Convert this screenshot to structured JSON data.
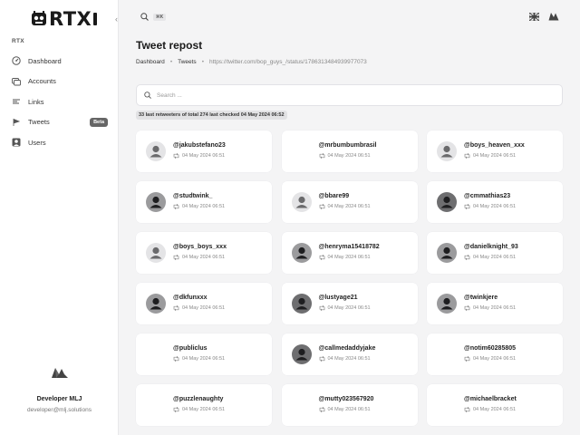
{
  "sidebar": {
    "logo_text": "RTX",
    "collapse_icon": "‹",
    "section_label": "RTX",
    "items": [
      {
        "label": "Dashboard",
        "icon": "gauge-icon"
      },
      {
        "label": "Accounts",
        "icon": "accounts-icon"
      },
      {
        "label": "Links",
        "icon": "links-icon"
      },
      {
        "label": "Tweets",
        "icon": "tweets-icon",
        "badge": "Beta"
      },
      {
        "label": "Users",
        "icon": "users-icon"
      }
    ],
    "profile": {
      "name": "Developer MLJ",
      "email": "developer@mlj.solutions"
    }
  },
  "topbar": {
    "shortcut": "⌘K"
  },
  "page": {
    "title": "Tweet repost",
    "breadcrumb": {
      "home": "Dashboard",
      "section": "Tweets",
      "current": "https://twitter.com/bop_guys_/status/1786313484939977073"
    }
  },
  "search": {
    "placeholder": "Search ..."
  },
  "status": "33 last retweeters of total 274 last checked 04 May 2024 06:52",
  "cards": [
    {
      "username": "@jakubstefano23",
      "date": "04 May 2024 06:51",
      "avatar": "light"
    },
    {
      "username": "@mrbumbumbrasil",
      "date": "04 May 2024 06:51",
      "avatar": "none"
    },
    {
      "username": "@boys_heaven_xxx",
      "date": "04 May 2024 06:51",
      "avatar": "light"
    },
    {
      "username": "@studtwink_",
      "date": "04 May 2024 06:51",
      "avatar": "mid"
    },
    {
      "username": "@bbare99",
      "date": "04 May 2024 06:51",
      "avatar": "light"
    },
    {
      "username": "@cmmathias23",
      "date": "04 May 2024 06:51",
      "avatar": "dark"
    },
    {
      "username": "@boys_boys_xxx",
      "date": "04 May 2024 06:51",
      "avatar": "light"
    },
    {
      "username": "@henryma15418782",
      "date": "04 May 2024 06:51",
      "avatar": "mid"
    },
    {
      "username": "@danielknight_93",
      "date": "04 May 2024 06:51",
      "avatar": "mid"
    },
    {
      "username": "@dkfunxxx",
      "date": "04 May 2024 06:51",
      "avatar": "mid"
    },
    {
      "username": "@lustyage21",
      "date": "04 May 2024 06:51",
      "avatar": "dark"
    },
    {
      "username": "@twinkjere",
      "date": "04 May 2024 06:51",
      "avatar": "mid"
    },
    {
      "username": "@publiclus",
      "date": "04 May 2024 06:51",
      "avatar": "none"
    },
    {
      "username": "@callmedaddyjake",
      "date": "04 May 2024 06:51",
      "avatar": "dark"
    },
    {
      "username": "@notim60285805",
      "date": "04 May 2024 06:51",
      "avatar": "none"
    },
    {
      "username": "@puzzlenaughty",
      "date": "04 May 2024 06:51",
      "avatar": "none"
    },
    {
      "username": "@mutty023567920",
      "date": "04 May 2024 06:51",
      "avatar": "none"
    },
    {
      "username": "@michaelbracket",
      "date": "04 May 2024 06:51",
      "avatar": "none"
    }
  ],
  "colors": {
    "avatar_light": "#e4e4e6",
    "avatar_mid": "#9b9b9d",
    "avatar_dark": "#6e6e70",
    "badge": "#666666"
  }
}
